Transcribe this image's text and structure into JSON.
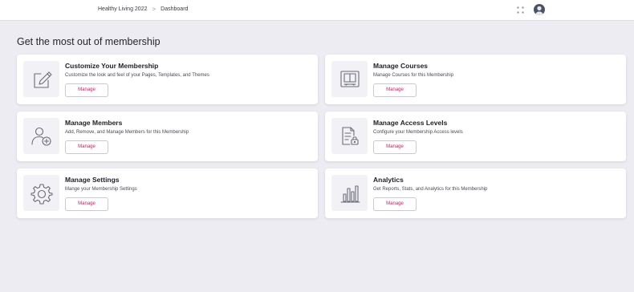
{
  "breadcrumb": {
    "items": [
      "Healthy Living 2022",
      "Dashboard"
    ],
    "separator": ">"
  },
  "header_icons": [
    "grid-icon",
    "avatar"
  ],
  "page_title": "Get the most out of membership",
  "colors": {
    "background": "#ececf2",
    "card": "#ffffff",
    "accent": "#c2255c",
    "icon_stroke": "#6b6b78"
  },
  "cards": [
    {
      "title": "Customize Your Membership",
      "description": "Customize the look and feel of your Pages, Templates, and Themes",
      "button": "Manage",
      "icon": "edit-icon"
    },
    {
      "title": "Manage Courses",
      "description": "Manage Courses for this Membership",
      "button": "Manage",
      "icon": "book-icon"
    },
    {
      "title": "Manage Members",
      "description": "Add, Remove, and Manage Members for this Membership",
      "button": "Manage",
      "icon": "add-user-icon"
    },
    {
      "title": "Manage Access Levels",
      "description": "Configure your Membership Access levels",
      "button": "Manage",
      "icon": "document-lock-icon"
    },
    {
      "title": "Manage Settings",
      "description": "Mange your Membership Settings",
      "button": "Manage",
      "icon": "gear-icon"
    },
    {
      "title": "Analytics",
      "description": "Get Reports, Stats, and Analytics for this Membership",
      "button": "Manage",
      "icon": "bar-chart-icon"
    }
  ]
}
